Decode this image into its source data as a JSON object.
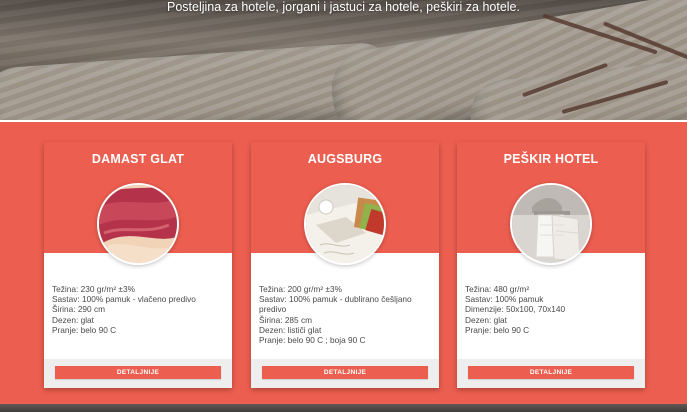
{
  "hero": {
    "tagline": "Posteljina za hotele, jorgani i jastuci za hotele, peškiri za hotele."
  },
  "products": [
    {
      "title": "DAMAST GLAT",
      "image_icon": "damask-fabric-image",
      "specs": [
        "Težina: 230 gr/m² ±3%",
        "Sastav: 100% pamuk - vlačeno predivo",
        "Širina: 290 cm",
        "Dezen: glat",
        "Pranje: belo 90 C"
      ],
      "button": "DETALJNIJE"
    },
    {
      "title": "AUGSBURG",
      "image_icon": "table-linen-image",
      "specs": [
        "Težina: 200 gr/m² ±3%",
        "Sastav: 100% pamuk - dublirano češljano predivo",
        "Širina: 285 cm",
        "Dezen: lističi glat",
        "Pranje: belo 90 C ; boja 90 C"
      ],
      "button": "DETALJNIJE"
    },
    {
      "title": "PEŠKIR HOTEL",
      "image_icon": "hotel-towel-image",
      "specs": [
        "Težina: 480 gr/m²",
        "Sastav: 100% pamuk",
        "Dimenzije: 50x100, 70x140",
        "Dezen: glat",
        "Pranje: belo 90 C"
      ],
      "button": "DETALJNIJE"
    }
  ],
  "colors": {
    "accent": "#ec5e4f",
    "card_body": "#ffffff",
    "footer_bg": "#eeeeee",
    "text": "#4a4a4a"
  }
}
